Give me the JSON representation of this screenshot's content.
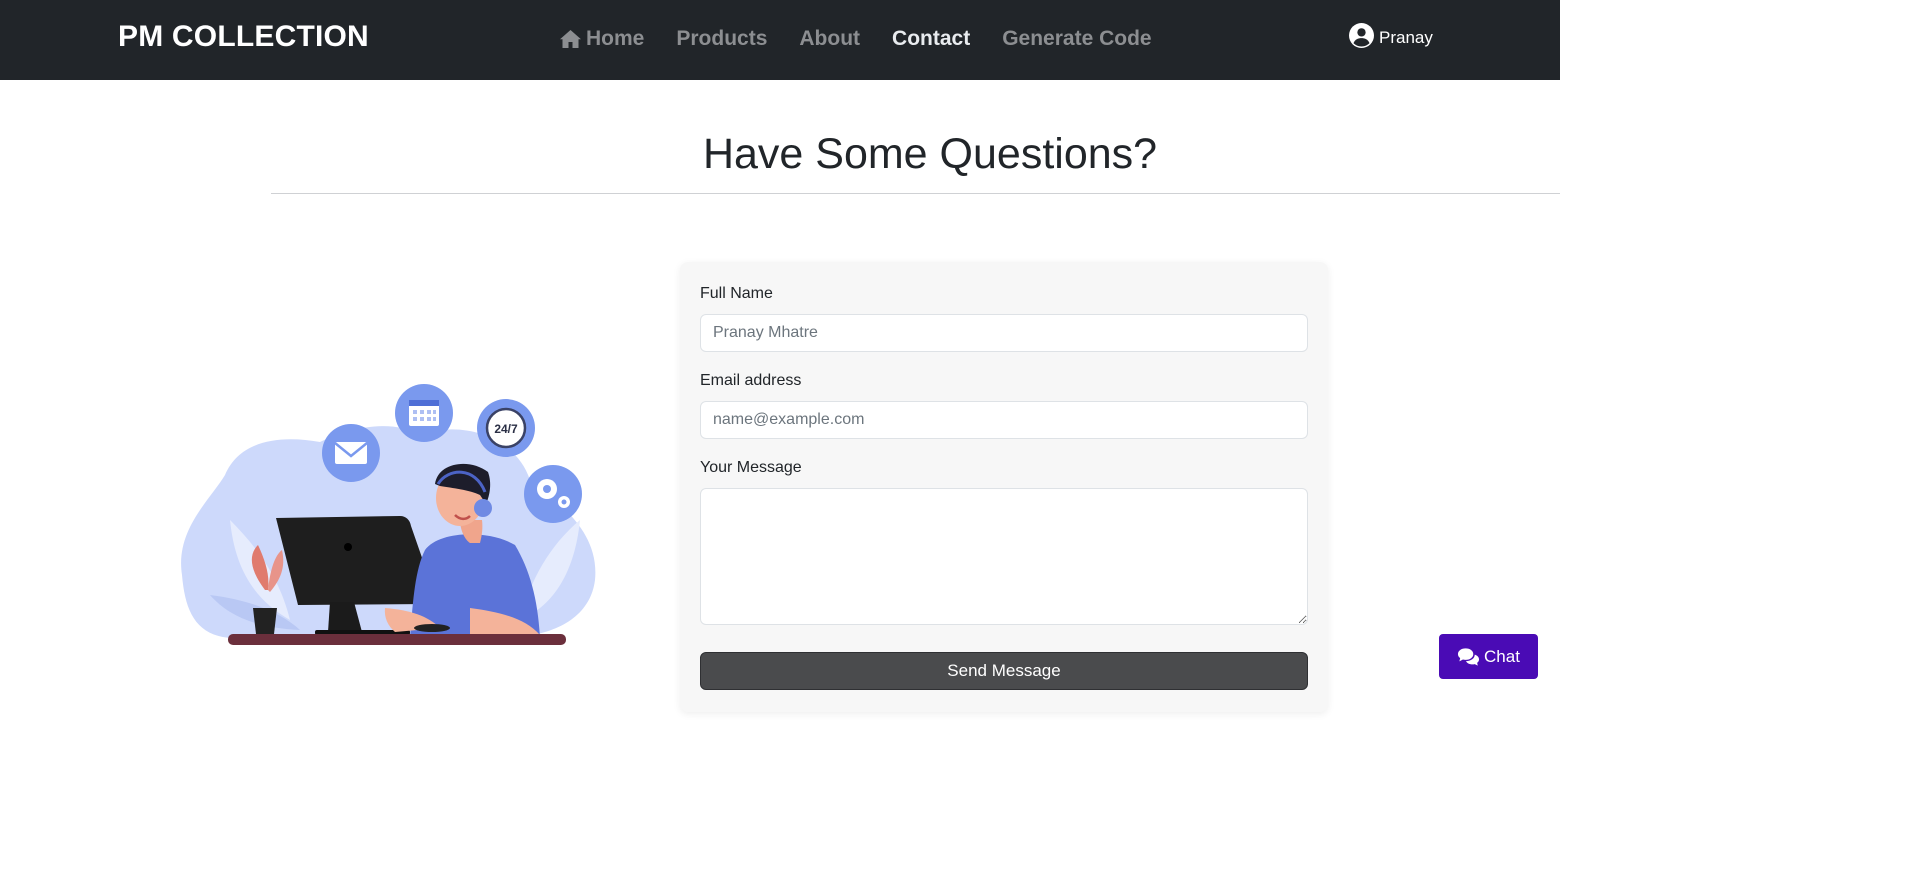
{
  "navbar": {
    "brand": "PM COLLECTION",
    "links": [
      {
        "label": "Home",
        "icon": "home-icon",
        "active": false
      },
      {
        "label": "Products",
        "active": false
      },
      {
        "label": "About",
        "active": false
      },
      {
        "label": "Contact",
        "active": true
      },
      {
        "label": "Generate Code",
        "active": false
      }
    ],
    "user": {
      "icon": "user-circle-icon",
      "name": "Pranay"
    }
  },
  "page": {
    "heading": "Have Some Questions?"
  },
  "illustration": {
    "badge_text": "24/7",
    "icons": [
      "mail-icon",
      "calendar-icon",
      "clock-24-7-icon",
      "gears-icon"
    ]
  },
  "form": {
    "full_name": {
      "label": "Full Name",
      "placeholder": "Pranay Mhatre",
      "value": ""
    },
    "email": {
      "label": "Email address",
      "placeholder": "name@example.com",
      "value": ""
    },
    "message": {
      "label": "Your Message",
      "placeholder": "",
      "value": ""
    },
    "submit_label": "Send Message"
  },
  "chat": {
    "label": "Chat",
    "icon": "chat-bubbles-icon"
  },
  "colors": {
    "navbar_bg": "#212529",
    "nav_inactive": "#8c8e91",
    "nav_active": "#e9ecef",
    "send_button": "#4a4b4d",
    "chat_button": "#4a0bb5",
    "illustration_accent": "#7a99ee"
  }
}
